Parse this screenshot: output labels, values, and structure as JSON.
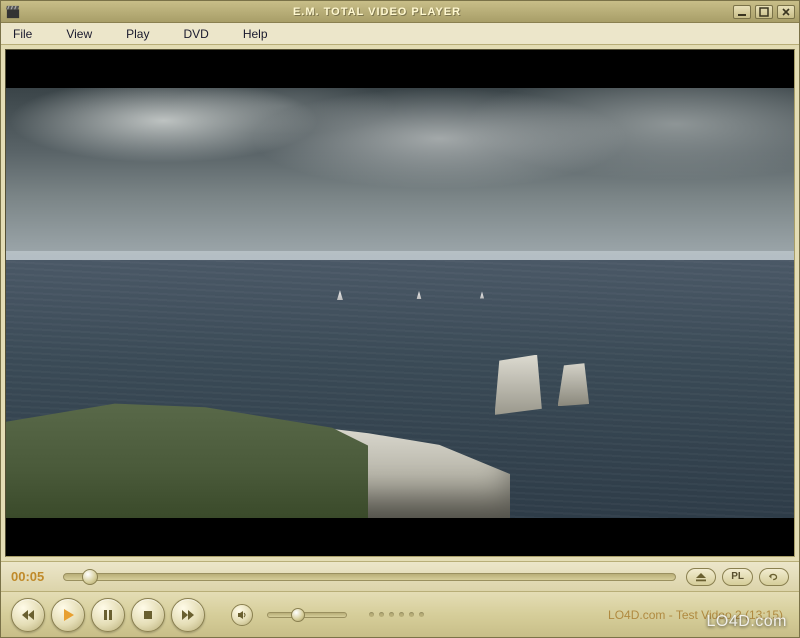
{
  "window": {
    "title": "E.M. TOTAL VIDEO PLAYER"
  },
  "menu": {
    "items": [
      "File",
      "View",
      "Play",
      "DVD",
      "Help"
    ]
  },
  "playback": {
    "current_time": "00:05",
    "progress_percent": 3,
    "now_playing": "LO4D.com - Test Video 2   (13:15)"
  },
  "volume": {
    "level_percent": 30
  },
  "buttons": {
    "playlist_label": "PL"
  },
  "icons": {
    "app": "clapper-icon",
    "minimize": "minimize-icon",
    "maximize": "maximize-icon",
    "close": "close-icon",
    "eject": "eject-icon",
    "playlist": "playlist-icon",
    "repeat": "repeat-icon",
    "previous": "previous-icon",
    "play": "play-icon",
    "pause": "pause-icon",
    "stop": "stop-icon",
    "next": "next-icon",
    "mute": "mute-icon"
  },
  "watermark": "LO4D.com"
}
